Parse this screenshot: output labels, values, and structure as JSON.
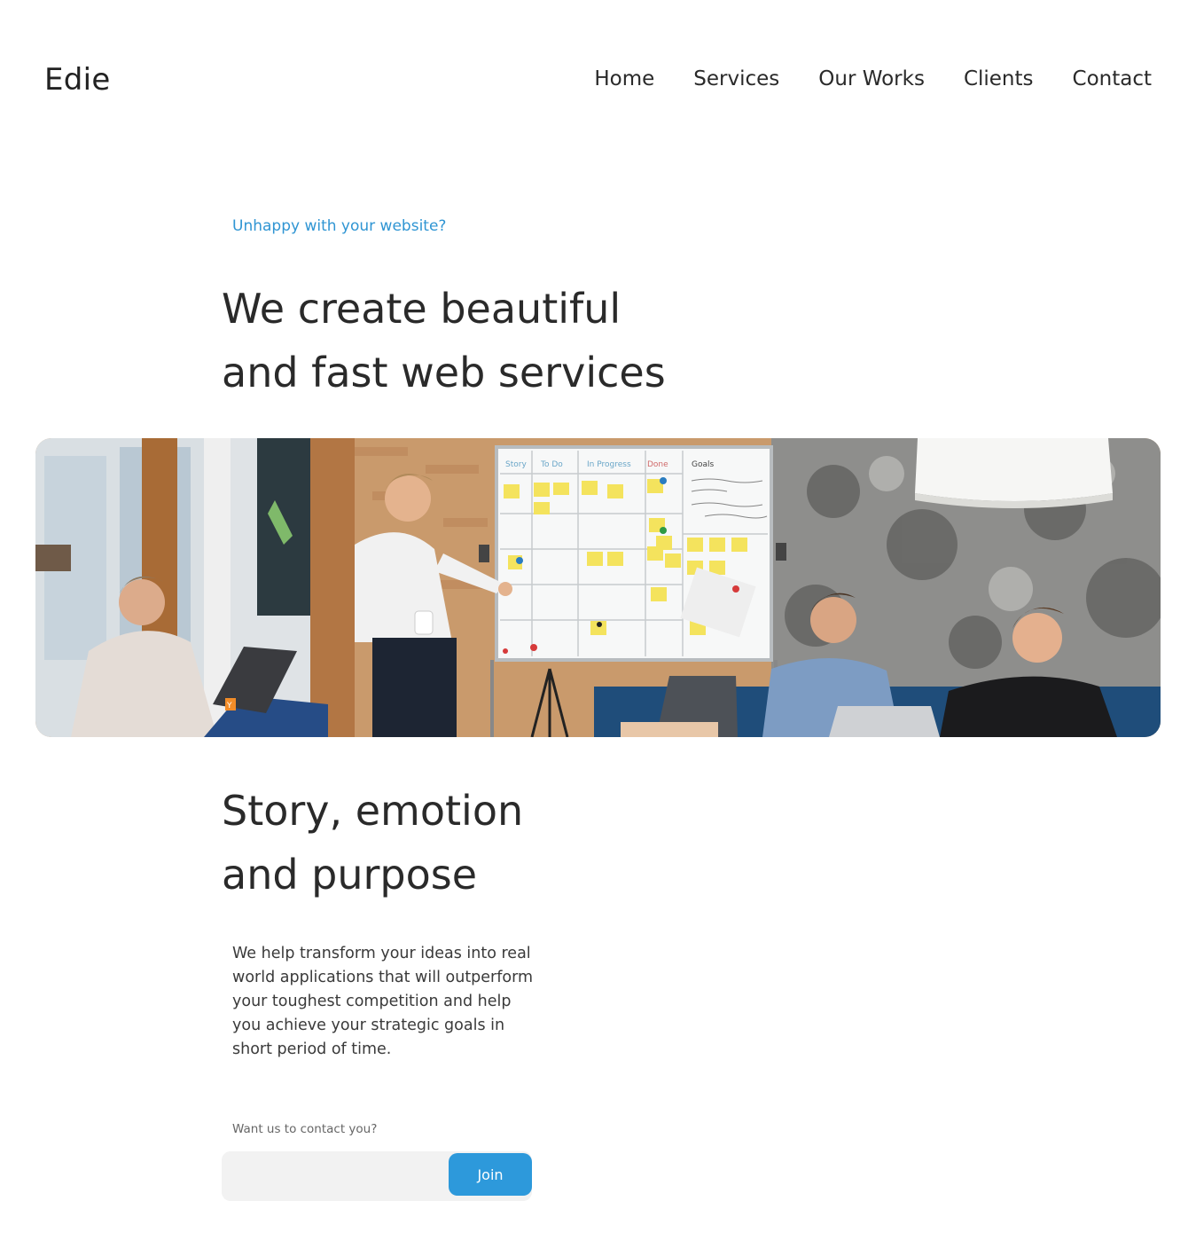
{
  "header": {
    "logo": "Edie",
    "nav": [
      "Home",
      "Services",
      "Our Works",
      "Clients",
      "Contact"
    ]
  },
  "hero": {
    "eyebrow": "Unhappy with your website?",
    "title_line1": "We create beautiful",
    "title_line2": "and fast web services"
  },
  "banner": {
    "whiteboard_columns": [
      "Story",
      "To Do",
      "In Progress",
      "Done",
      "Goals"
    ],
    "laptop_sticker": "Y"
  },
  "section": {
    "title_line1": "Story, emotion",
    "title_line2": "and purpose",
    "body": "We help transform your ideas into real world applications that will outperform your toughest competition and help you achieve your strategic goals in short period of time."
  },
  "contact": {
    "label": "Want us to contact you?",
    "input_value": "",
    "input_placeholder": "",
    "button_label": "Join"
  },
  "colors": {
    "accent": "#2f95d3",
    "button": "#2d99db",
    "text": "#2a2a2a",
    "input_bg": "#f2f2f2"
  }
}
